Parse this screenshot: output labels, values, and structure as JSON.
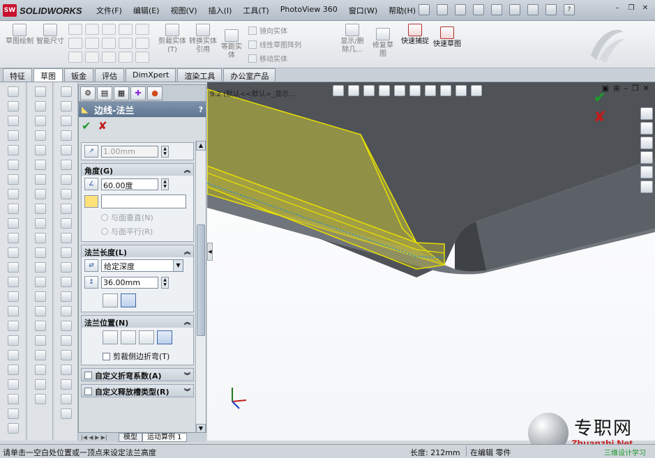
{
  "app": {
    "logo_mark": "SW",
    "logo_name": "SOLIDWORKS",
    "menus": [
      "文件(F)",
      "编辑(E)",
      "视图(V)",
      "插入(I)",
      "工具(T)",
      "PhotoView 360",
      "窗口(W)",
      "帮助(H)"
    ]
  },
  "ribbon": {
    "sketch": "草图绘制",
    "smart_dim": "智能尺寸",
    "trim": "剪裁实体(T)",
    "convert": "转换实体引用",
    "offset": "等距实体",
    "mirror": "镜向实体",
    "linear_pattern": "线性草图阵列",
    "move": "移动实体",
    "show_delete": "显示/删除几...",
    "repair": "修复草图",
    "quick_snap": "快速捕捉",
    "rapid_sketch": "快速草图"
  },
  "tabs": [
    "特征",
    "草图",
    "钣金",
    "评估",
    "DimXpert",
    "渲染工具",
    "办公室产品"
  ],
  "tabs_active": "草图",
  "pm": {
    "title": "边线-法兰",
    "help": "?",
    "radius_value": "1.00mm",
    "angle_group": "角度(G)",
    "angle_value": "60.00度",
    "perpendicular": "与面垂直(N)",
    "parallel": "与面平行(R)",
    "length_group": "法兰长度(L)",
    "length_type": "给定深度",
    "length_value": "36.00mm",
    "position_group": "法兰位置(N)",
    "trim_side": "剪裁侧边折弯(T)",
    "custom_bend": "自定义折弯系数(A)",
    "custom_relief": "自定义释放槽类型(R)"
  },
  "bottom_tabs": [
    "模型",
    "运动算例 1"
  ],
  "viewport": {
    "tree_text": "9.2    (默认<<默认>_显示..."
  },
  "watermark": {
    "cn": "专职网",
    "en": "Zhuanzhi.Net"
  },
  "status": {
    "prompt": "请单击一空白处位置或一顶点来设定法兰高度",
    "length": "长度: 212mm",
    "mode": "在编辑 零件",
    "extra": "三维设计学习"
  },
  "colors": {
    "accent_red": "#c31b1b",
    "ok_green": "#1d9a2c",
    "preview_yellow": "#e8e000",
    "part_gray": "#4f5358"
  }
}
